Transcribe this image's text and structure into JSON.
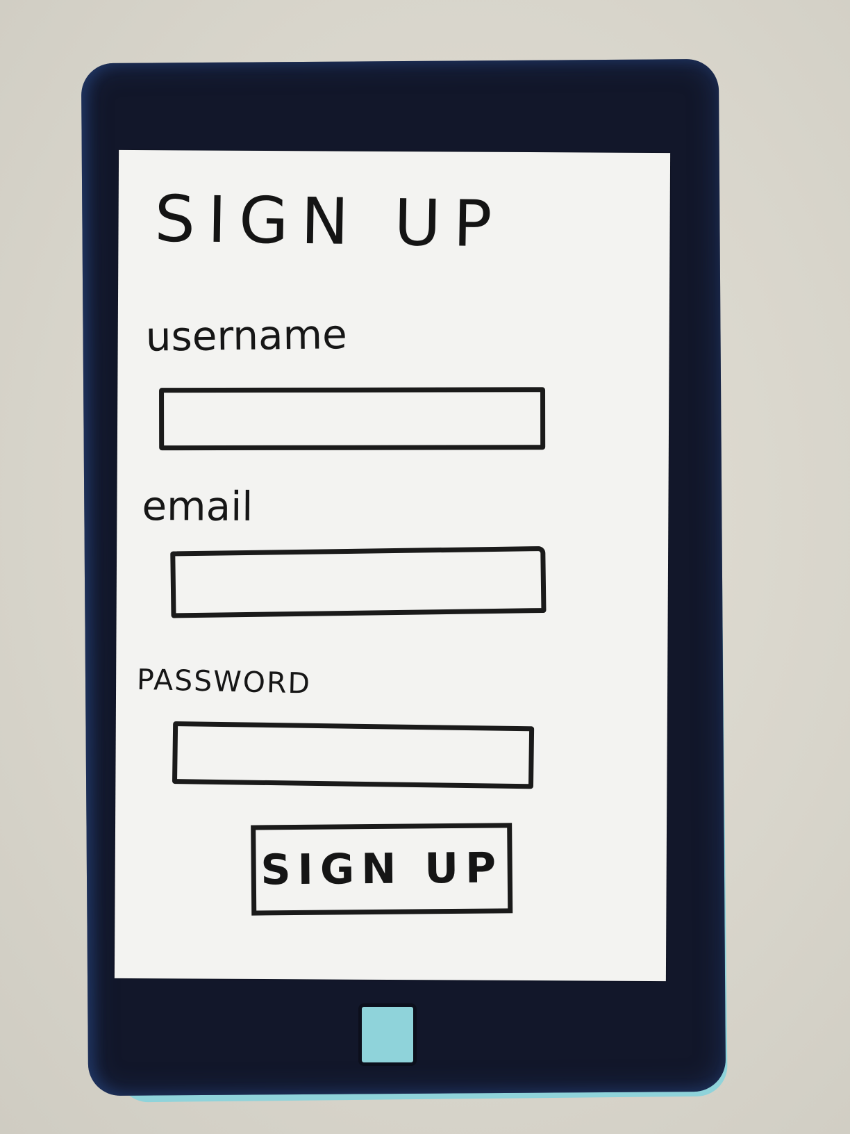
{
  "screen": {
    "title": "SIGN UP",
    "fields": [
      {
        "label": "username",
        "value": ""
      },
      {
        "label": "email",
        "value": ""
      },
      {
        "label": "password",
        "value": ""
      }
    ],
    "submit_label": "SIGN UP"
  },
  "device": {
    "home_button_icon": "home-button-square"
  },
  "colors": {
    "device_body": "#12172a",
    "device_accent": "#8fd3da",
    "screen_paper": "#f3f3f1",
    "ink": "#1a1a1a"
  }
}
